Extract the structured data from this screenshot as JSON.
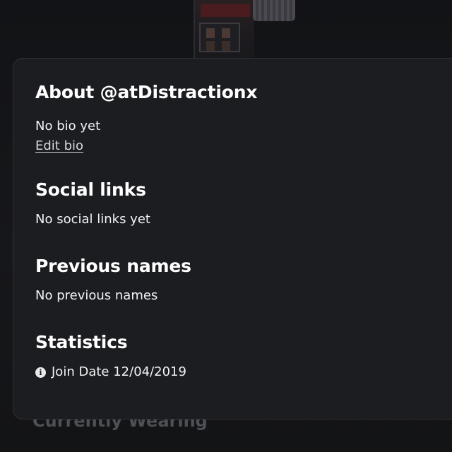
{
  "about": {
    "heading": "About @atDistractionx",
    "bio": "No bio yet",
    "edit_bio_label": "Edit bio"
  },
  "social": {
    "heading": "Social links",
    "empty_text": "No social links yet"
  },
  "previous_names": {
    "heading": "Previous names",
    "empty_text": "No previous names"
  },
  "statistics": {
    "heading": "Statistics",
    "join_label": "Join Date",
    "join_value": "12/04/2019",
    "icon": "info-icon"
  },
  "wearing": {
    "heading": "Currently Wearing"
  }
}
